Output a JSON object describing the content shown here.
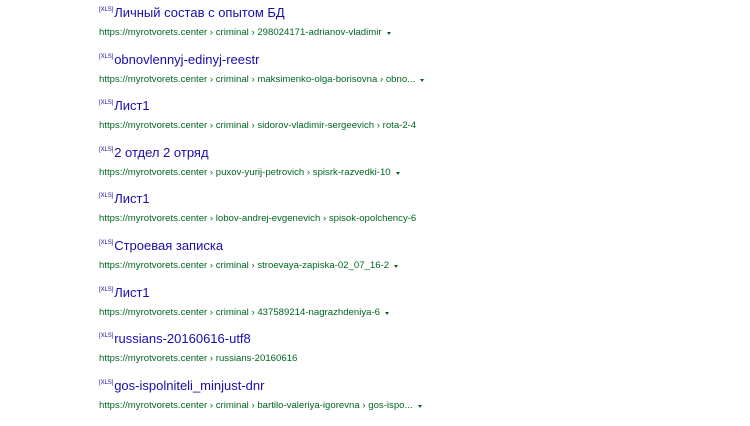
{
  "filetype_label": "[XLS]",
  "results": [
    {
      "title": "Личный состав с опытом БД",
      "url": "https://myrotvorets.center › criminal › 298024171-adrianov-vladimir",
      "has_menu": true
    },
    {
      "title": "obnovlennyj-edinyj-reestr",
      "url": "https://myrotvorets.center › criminal › maksimenko-olga-borisovna › obno...",
      "has_menu": true
    },
    {
      "title": "Лист1",
      "url": "https://myrotvorets.center › criminal › sidorov-vladimir-sergeevich › rota-2-4",
      "has_menu": false
    },
    {
      "title": "2 отдел 2 отряд",
      "url": "https://myrotvorets.center › puxov-yurij-petrovich › spisrk-razvedki-10",
      "has_menu": true
    },
    {
      "title": "Лист1",
      "url": "https://myrotvorets.center › lobov-andrej-evgenevich › spisok-opolchency-6",
      "has_menu": false
    },
    {
      "title": "Строевая записка",
      "url": "https://myrotvorets.center › criminal › stroevaya-zapiska-02_07_16-2",
      "has_menu": true
    },
    {
      "title": "Лист1",
      "url": "https://myrotvorets.center › criminal › 437589214-nagrazhdeniya-6",
      "has_menu": true
    },
    {
      "title": "russians-20160616-utf8",
      "url": "https://myrotvorets.center › russians-20160616",
      "has_menu": false
    },
    {
      "title": "gos-ispolniteli_minjust-dnr",
      "url": "https://myrotvorets.center › criminal › bartilo-valeriya-igorevna › gos-ispo...",
      "has_menu": true
    }
  ],
  "colors": {
    "title": "#1a0dab",
    "url": "#006621"
  }
}
